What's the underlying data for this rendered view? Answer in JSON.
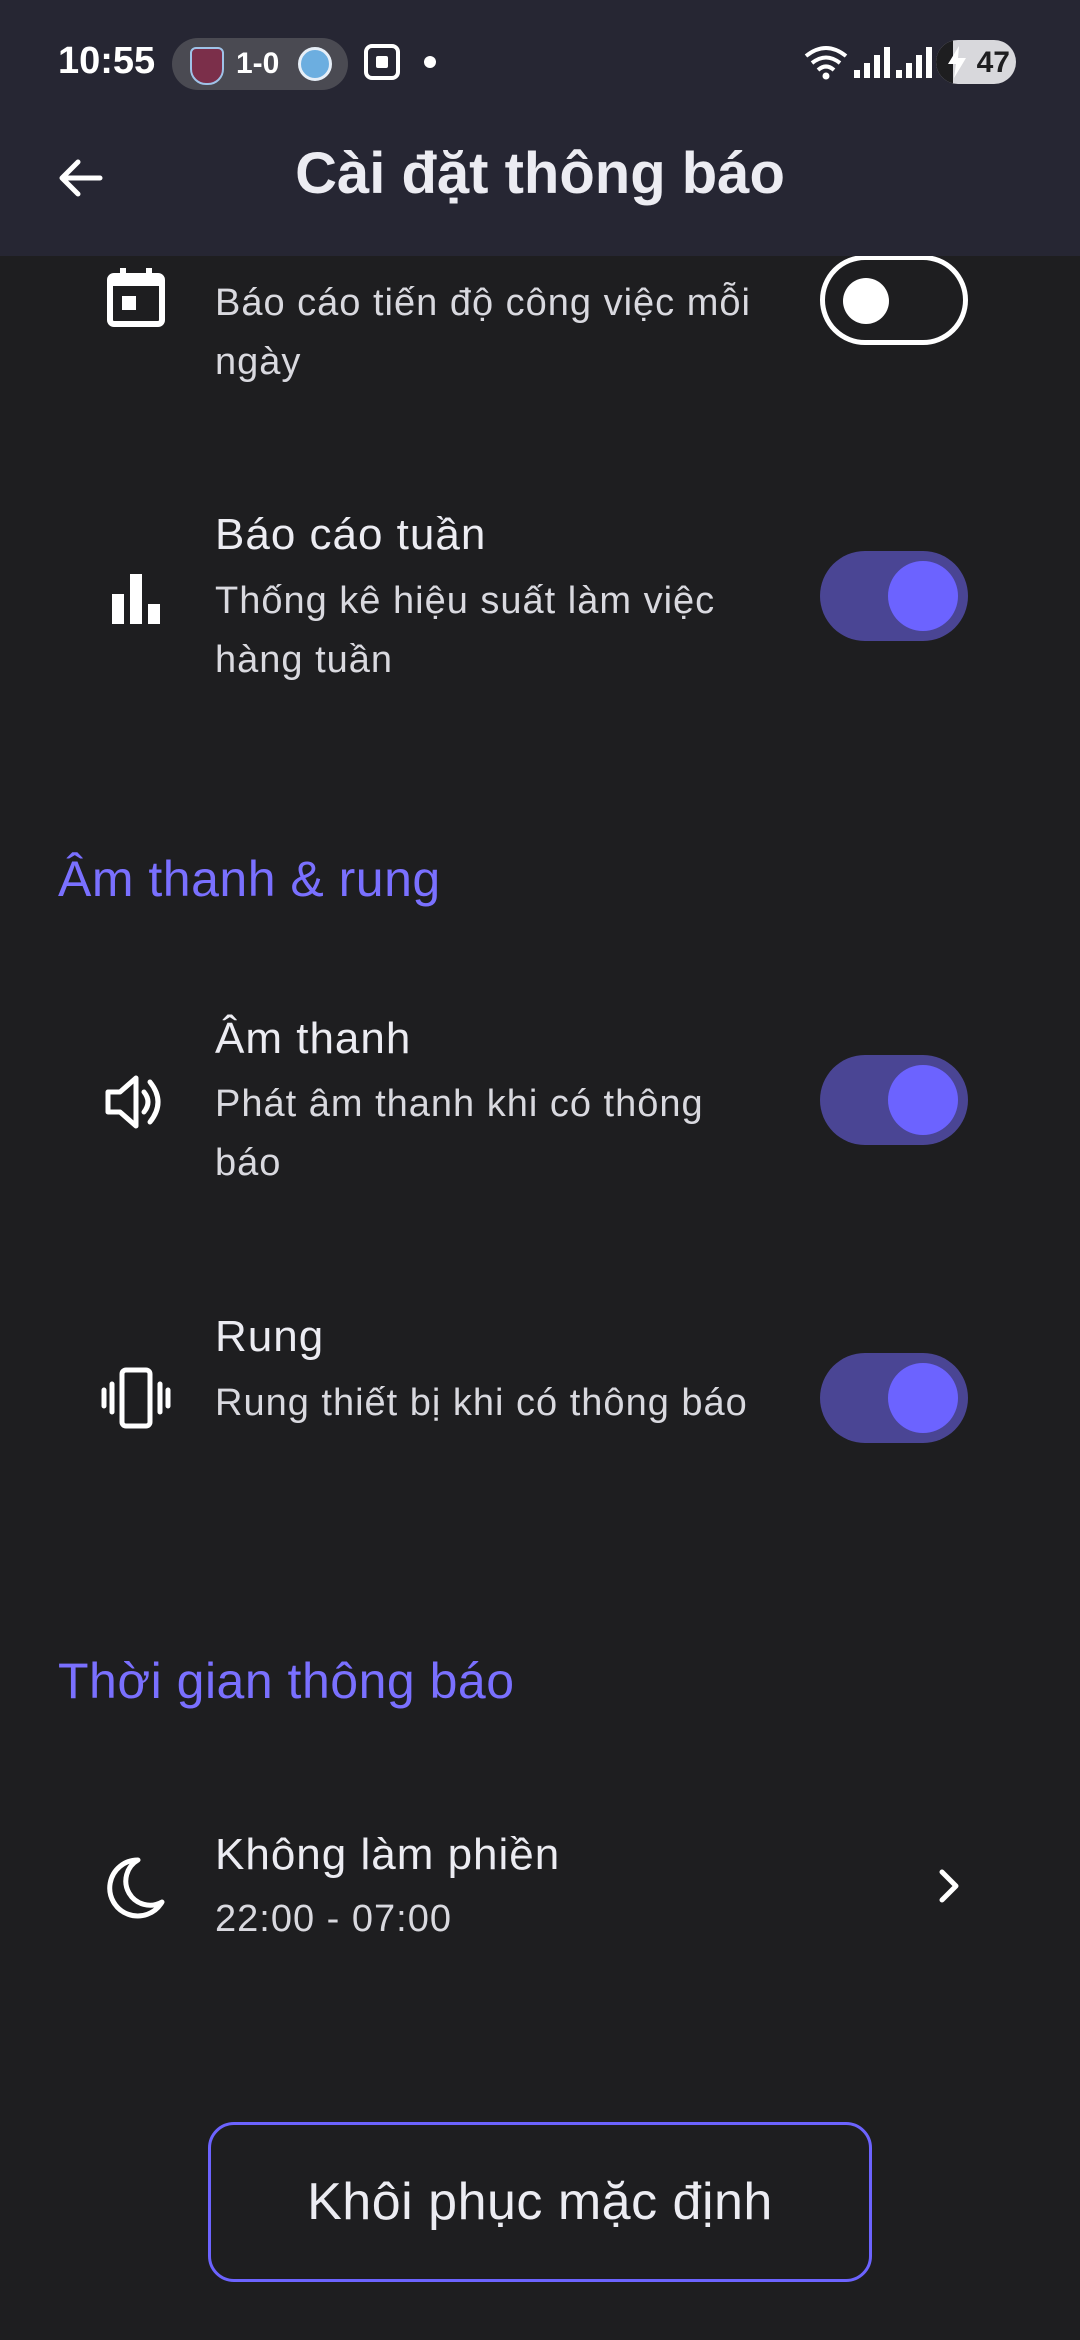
{
  "status_bar": {
    "time": "10:55",
    "score": "1-0",
    "battery_percent": "47",
    "battery_level": 0.47
  },
  "header": {
    "title": "Cài đặt thông báo",
    "back_icon": "arrow-left-icon"
  },
  "reports": {
    "daily": {
      "subtitle": "Báo cáo tiến độ công việc mỗi ngày",
      "enabled": false,
      "icon": "calendar-icon"
    },
    "weekly": {
      "title": "Báo cáo tuần",
      "subtitle": "Thống kê hiệu suất làm việc hàng tuần",
      "enabled": true,
      "icon": "bar-chart-icon"
    }
  },
  "sound_section": {
    "heading": "Âm thanh & rung",
    "sound": {
      "title": "Âm thanh",
      "subtitle": "Phát âm thanh khi có thông báo",
      "enabled": true,
      "icon": "volume-icon"
    },
    "vibrate": {
      "title": "Rung",
      "subtitle": "Rung thiết bị khi có thông báo",
      "enabled": true,
      "icon": "vibrate-icon"
    }
  },
  "time_section": {
    "heading": "Thời gian thông báo",
    "dnd": {
      "title": "Không làm phiền",
      "value": "22:00 - 07:00",
      "icon": "moon-icon"
    }
  },
  "reset_button": "Khôi phục mặc định",
  "colors": {
    "accent": "#6c63ff",
    "toggle_track_on": "#4a4594",
    "background": "#1e1e20",
    "header_bg": "#262633"
  }
}
